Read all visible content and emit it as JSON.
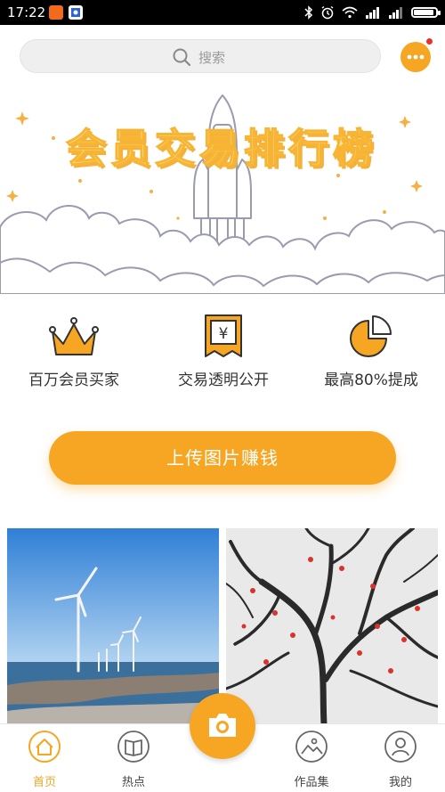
{
  "status_bar": {
    "time": "17:22",
    "battery_level": 0.9
  },
  "search": {
    "placeholder": "搜索"
  },
  "banner": {
    "title": "会员交易排行榜"
  },
  "features": [
    {
      "label": "百万会员买家",
      "icon": "crown-icon"
    },
    {
      "label": "交易透明公开",
      "icon": "receipt-yen-icon"
    },
    {
      "label": "最高80%提成",
      "icon": "pie-chart-icon"
    }
  ],
  "upload_button": {
    "label": "上传图片赚钱"
  },
  "gallery": [
    {
      "subject": "wind-turbines-photo"
    },
    {
      "subject": "snowy-tree-photo"
    }
  ],
  "tabs": [
    {
      "label": "首页",
      "icon": "home-icon",
      "active": true
    },
    {
      "label": "热点",
      "icon": "book-icon",
      "active": false
    },
    {
      "label": "作品集",
      "icon": "gallery-icon",
      "active": false
    },
    {
      "label": "我的",
      "icon": "user-icon",
      "active": false
    }
  ],
  "colors": {
    "accent": "#f6a623",
    "badge": "#e8302f"
  }
}
